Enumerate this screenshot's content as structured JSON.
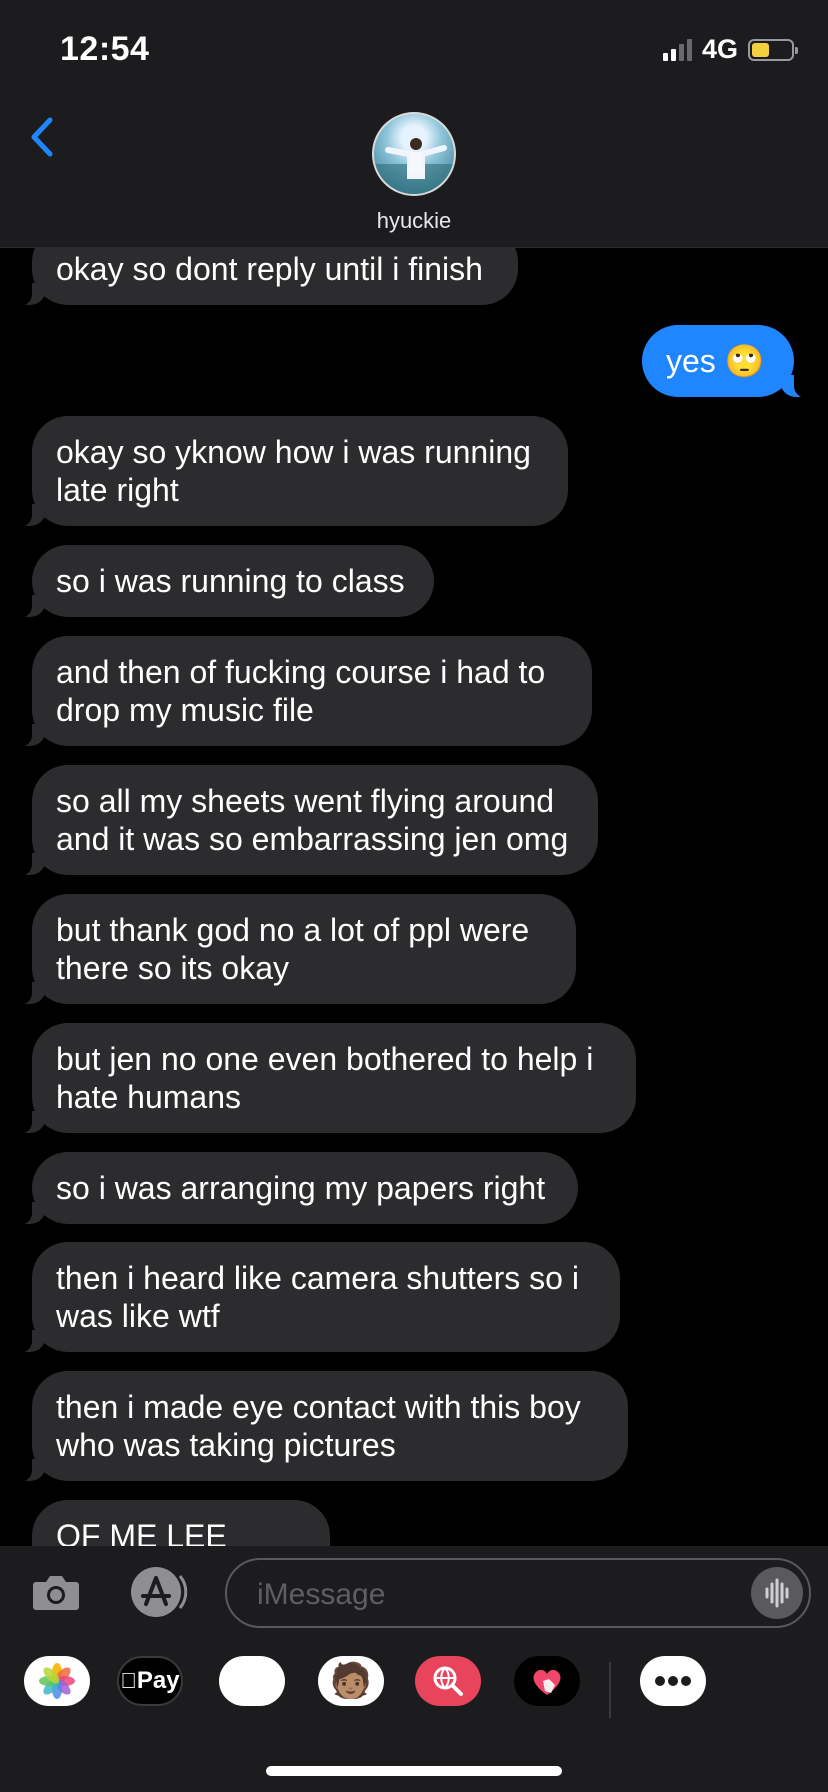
{
  "status": {
    "time": "12:54",
    "network": "4G",
    "battery_level": 0.45,
    "battery_color": "#f4d03f"
  },
  "header": {
    "contact_name": "hyuckie",
    "back_icon": "chevron-left-icon",
    "accent": "#1f86ff"
  },
  "messages": [
    {
      "side": "in",
      "text": "okay so dont reply until i finish"
    },
    {
      "side": "out",
      "text": "yes 🙄"
    },
    {
      "side": "in",
      "text": "okay so yknow how i was running late right"
    },
    {
      "side": "in",
      "text": "so i was running to class"
    },
    {
      "side": "in",
      "text": "and then of fucking course i had to drop my music file"
    },
    {
      "side": "in",
      "text": "so all my sheets went flying around and it was so embarrassing jen omg"
    },
    {
      "side": "in",
      "text": "but thank god no a lot of ppl were there so its okay"
    },
    {
      "side": "in",
      "text": "but jen no one even bothered to help i hate humans"
    },
    {
      "side": "in",
      "text": "so i was arranging my papers right"
    },
    {
      "side": "in",
      "text": "then i heard like camera shutters so i was like wtf"
    },
    {
      "side": "in",
      "text": "then i made eye contact with this boy who was taking pictures"
    },
    {
      "side": "in",
      "text": "OF ME LEE JENO"
    }
  ],
  "composer": {
    "placeholder": "iMessage",
    "camera_icon": "camera-icon",
    "apps_icon": "app-store-icon",
    "audio_icon": "audio-waveform-icon"
  },
  "app_drawer": [
    {
      "name": "photos",
      "icon": "photos-icon"
    },
    {
      "name": "apple-pay",
      "icon": "apple-pay-icon",
      "label": "Pay"
    },
    {
      "name": "animoji",
      "icon": "monkey-icon",
      "glyph": "🐵"
    },
    {
      "name": "memoji",
      "icon": "memoji-icon",
      "glyph": "🧑🏽"
    },
    {
      "name": "images-search",
      "icon": "globe-search-icon"
    },
    {
      "name": "digital-touch",
      "icon": "heart-touch-icon"
    },
    {
      "name": "more",
      "icon": "more-icon"
    }
  ],
  "colors": {
    "bubble_in": "#2c2c2e",
    "bubble_out": "#1f86ff",
    "background": "#000000",
    "bar": "#1c1c1e"
  }
}
